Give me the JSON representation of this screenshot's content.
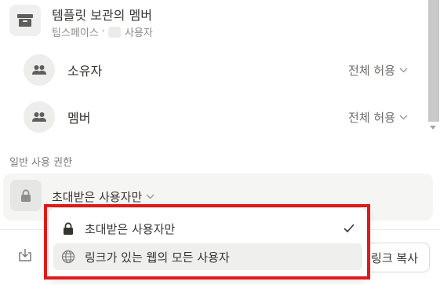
{
  "template": {
    "title": "템플릿 보관의 멤버",
    "subtitle_workspace": "팀스페이스",
    "subtitle_separator": "·",
    "subtitle_users": "사용자"
  },
  "members": [
    {
      "name": "소유자",
      "access": "전체 허용"
    },
    {
      "name": "멤버",
      "access": "전체 허용"
    }
  ],
  "general_access": {
    "section_label": "일반 사용 권한",
    "selected": "초대받은 사용자만"
  },
  "dropdown": {
    "items": [
      {
        "label": "초대받은 사용자만",
        "icon": "lock-icon",
        "checked": true
      },
      {
        "label": "링크가 있는 웹의 모든 사용자",
        "icon": "globe-icon",
        "checked": false
      }
    ]
  },
  "footer": {
    "copy_link_label": "링크 복사"
  },
  "colors": {
    "text": "#37352f",
    "secondary_text": "#6f6e69",
    "card_background": "#f5f5f4",
    "annotation_border": "#e0191b"
  }
}
